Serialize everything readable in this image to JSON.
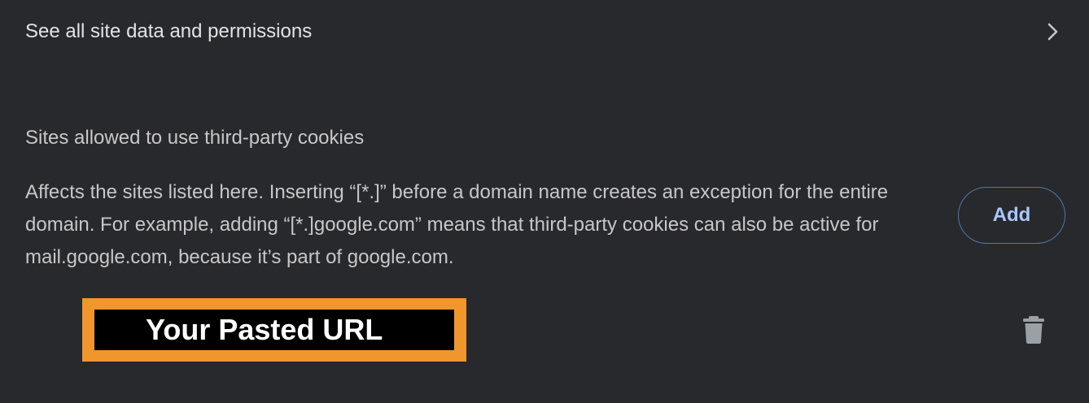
{
  "all_site_data": {
    "label": "See all site data and permissions",
    "chevron_icon": "chevron-right-icon"
  },
  "third_party_section": {
    "title": "Sites allowed to use third-party cookies",
    "description": "Affects the sites listed here. Inserting “[*.]” before a domain name creates an exception for the entire domain. For example, adding “[*.]google.com” means that third-party cookies can also be active for mail.google.com, because it’s part of google.com.",
    "add_label": "Add"
  },
  "sites": [
    {
      "url": "Your Pasted URL",
      "delete_icon": "trash-icon"
    }
  ],
  "colors": {
    "background": "#28292c",
    "text": "#e3e3e3",
    "accent_text": "#a8c7fa",
    "accent_border": "#4f79a8",
    "highlight_frame": "#f0962d"
  }
}
